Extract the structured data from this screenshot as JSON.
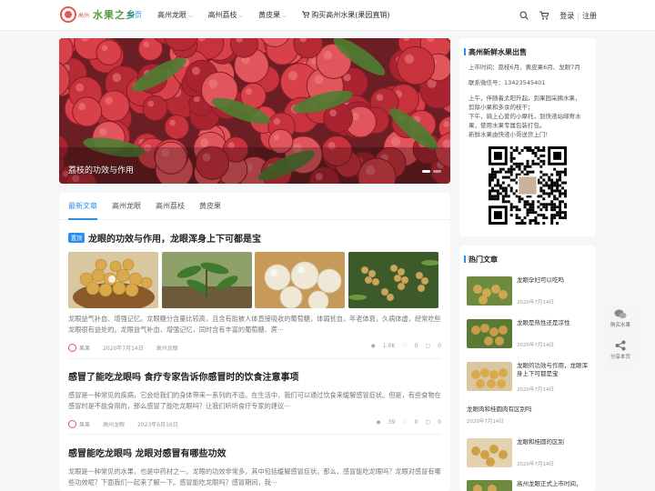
{
  "site": {
    "logo_text": "水果之乡",
    "logo_sub": "高州"
  },
  "nav": {
    "items": [
      {
        "label": "首页",
        "active": true,
        "caret": false
      },
      {
        "label": "高州龙眼",
        "active": false,
        "caret": true
      },
      {
        "label": "高州荔枝",
        "active": false,
        "caret": true
      },
      {
        "label": "黄皮果",
        "active": false,
        "caret": true
      },
      {
        "label": "购买高州水果(果园直销)",
        "active": false,
        "caret": false
      }
    ],
    "login": "登录",
    "register": "注册",
    "sep": "|"
  },
  "hero": {
    "caption": "荔枝的功效与作用"
  },
  "tabs": [
    "最新文章",
    "高州龙眼",
    "高州荔枝",
    "黄皮果"
  ],
  "posts": [
    {
      "badge": "置顶",
      "title": "龙眼的功效与作用，龙眼浑身上下可都是宝",
      "excerpt": "龙眼益气补血、增强记忆。龙眼糖分含量比较高，且含有能被人体直接吸收的葡萄糖，体弱贫血，年老体衰，久病体虚，经常吃些龙眼很有益处的。龙眼益气补血，增强记忆，同时含有丰富的葡萄糖、蔗···",
      "author": "果果",
      "date": "2020年7月14日",
      "category": "高州龙眼",
      "views": "1.0K",
      "likes": "0",
      "comments": "0"
    },
    {
      "badge": "",
      "title": "感冒了能吃龙眼吗 食疗专家告诉你感冒时的饮食注意事项",
      "excerpt": "感冒是一种常见的疾病，它会给我们的身体带来一系列的不适。在生活中，我们可以通过饮食来缓解感冒症状。但是，有些食物在感冒时是不能食用的，那么感冒了能吃龙眼吗？让我们听听食疗专家的建议···",
      "author": "果果",
      "date": "2023年6月16日",
      "category": "高州龙眼",
      "views": "39",
      "likes": "0",
      "comments": "0"
    },
    {
      "badge": "",
      "title": "感冒能吃龙眼吗 龙眼对感冒有哪些功效",
      "excerpt": "龙眼是一种常见的水果，也是中药材之一。龙眼的功效非常多，其中包括缓解感冒症状。那么，感冒能吃龙眼吗？龙眼对感冒有哪些功效呢？下面我们一起来了解一下。感冒能吃龙眼吗？感冒期间，我···",
      "author": "",
      "date": "",
      "category": "",
      "views": "",
      "likes": "",
      "comments": ""
    }
  ],
  "sidebar": {
    "sale": {
      "title": "高州新鲜水果出售",
      "line1": "上市时间：荔枝6月、黄皮果6月、龙眼7月",
      "line2": "联系微信号：13423545401",
      "para": [
        "上午，伴随着太阳升起，到果园采摘水果，",
        "剪除小果和多余的枝干；",
        "下午，骑上心爱的小摩托，到快递站邮寄水",
        "果，使用水果专属包装打包。",
        "新鲜水果由快递小哥送货上门!"
      ]
    },
    "hot": {
      "title": "热门文章",
      "items": [
        {
          "title": "龙眼孕妇可以吃吗",
          "date": "2020年7月14日"
        },
        {
          "title": "龙眼是热性还是凉性",
          "date": "2020年7月14日"
        },
        {
          "title": "龙眼的功效与作用，龙眼浑身上下可都是宝",
          "date": "2020年7月14日"
        },
        {
          "title": "龙眼肉和桂圆肉有区别吗",
          "date": "2020年7月14日"
        },
        {
          "title": "龙眼和桂圆的区别",
          "date": "2020年7月14日"
        },
        {
          "title": "高州龙眼正式上市时间，",
          "date": ""
        }
      ]
    }
  },
  "float": {
    "buy": "购买水果",
    "share": "分享本页"
  },
  "colors": {
    "accent": "#2b8ef0",
    "lychee": "#d8404a",
    "leaf": "#4f7d32"
  }
}
